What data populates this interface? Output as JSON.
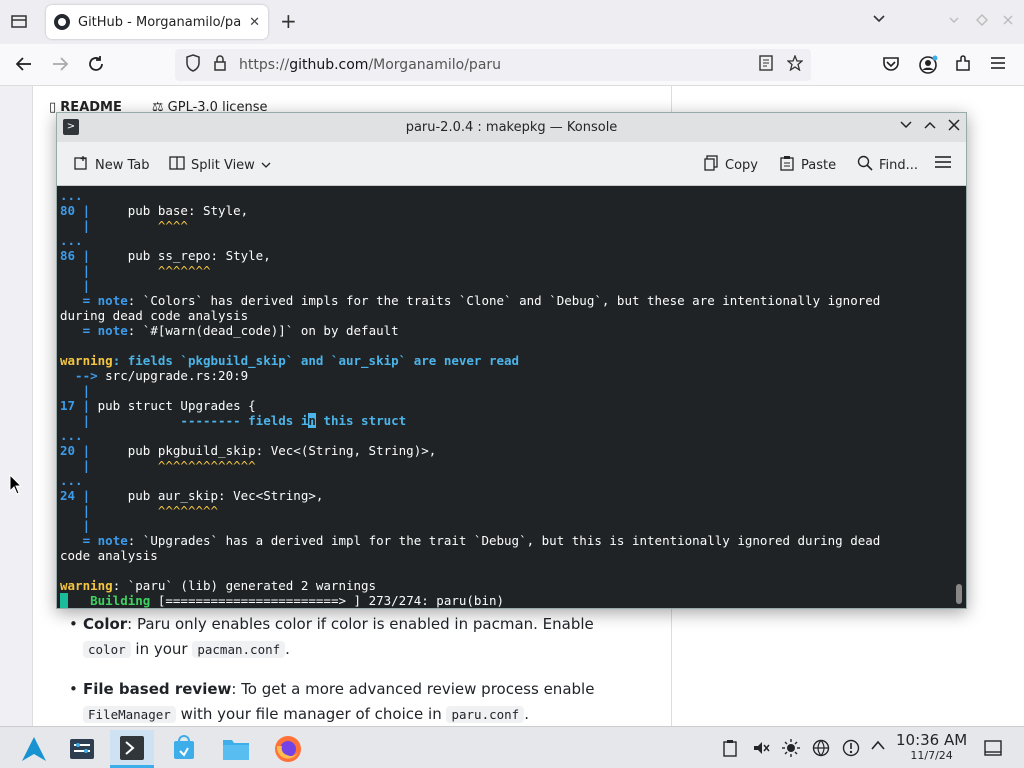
{
  "browser": {
    "tab_title": "GitHub - Morganamilo/par",
    "tab_close": "✕",
    "new_tab": "+",
    "url_prefix": "https://",
    "url_host": "github.com",
    "url_path": "/Morganamilo/paru"
  },
  "page": {
    "readme_label": "README",
    "license_label": "GPL-3.0 license",
    "bullet1_bold": "Color",
    "bullet1_text": ": Paru only enables color if color is enabled in pacman. Enable",
    "bullet1_code1": "color",
    "bullet1_text2": " in your ",
    "bullet1_code2": "pacman.conf",
    "bullet1_end": ".",
    "bullet2_bold": "File based review",
    "bullet2_text": ": To get a more advanced review process enable",
    "bullet2_code1": "FileManager",
    "bullet2_text2": " with your file manager of choice in ",
    "bullet2_code2": "paru.conf",
    "bullet2_end": "."
  },
  "konsole": {
    "title": "paru-2.0.4 : makepkg — Konsole",
    "new_tab": "New Tab",
    "split_view": "Split View",
    "copy": "Copy",
    "paste": "Paste",
    "find": "Find..."
  },
  "terminal": {
    "l1": "...",
    "l2_num": "80 |",
    "l2_text": "     pub base: Style,",
    "l3": "   |         ^^^^",
    "l4": "...",
    "l5_num": "86 |",
    "l5_text": "     pub ss_repo: Style,",
    "l6": "   |         ^^^^^^^",
    "l7": "   |",
    "l8_eq": "   = ",
    "l8_note": "note",
    "l8_text": ": `Colors` has derived impls for the traits `Clone` and `Debug`, but these are intentionally ignored",
    "l9": "during dead code analysis",
    "l10_eq": "   = ",
    "l10_note": "note",
    "l10_text": ": `#[warn(dead_code)]` on by default",
    "l12_warn": "warning",
    "l12_text": ": fields `pkgbuild_skip` and `aur_skip` are never read",
    "l13_arrow": "  --> ",
    "l13_text": "src/upgrade.rs:20:9",
    "l14": "   |",
    "l15_num": "17 |",
    "l15_text": " pub struct Upgrades {",
    "l16_bar": "   |",
    "l16_dash": "            -------- fields i",
    "l16_cur": "n",
    "l16_rest": " this struct",
    "l17": "...",
    "l18_num": "20 |",
    "l18_text": "     pub pkgbuild_skip: Vec<(String, String)>,",
    "l19": "   |         ^^^^^^^^^^^^^",
    "l20": "...",
    "l21_num": "24 |",
    "l21_text": "     pub aur_skip: Vec<String>,",
    "l22": "   |         ^^^^^^^^",
    "l23": "   |",
    "l24_eq": "   = ",
    "l24_note": "note",
    "l24_text": ": `Upgrades` has a derived impl for the trait `Debug`, but this is intentionally ignored during dead",
    "l25": "code analysis",
    "l27_warn": "warning",
    "l27_text": ": `paru` (lib) generated 2 warnings",
    "l28_build": "   Building",
    "l28_text": " [=======================> ] 273/274: paru(bin)"
  },
  "taskbar": {
    "time": "10:36 AM",
    "date": "11/7/24"
  },
  "colors": {
    "terminal_bg": "#1f2326",
    "accent": "#3daee9",
    "warning": "#f4c542",
    "note": "#3d9be9",
    "building": "#3fd060"
  }
}
